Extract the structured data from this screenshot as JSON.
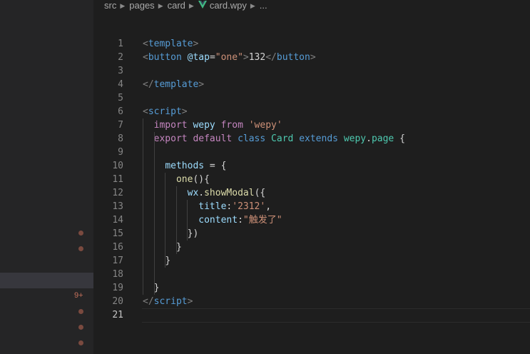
{
  "breadcrumb": {
    "items": [
      "src",
      "pages",
      "card",
      "card.wpy",
      "..."
    ],
    "file_icon": "vue-icon"
  },
  "sidebar": {
    "badge": "9+",
    "markers": [
      "dot-icon",
      "dot-icon",
      "dot-icon",
      "dot-icon",
      "dot-icon"
    ]
  },
  "editor": {
    "active_line": "21",
    "lines": [
      {
        "n": "1",
        "tokens": [
          [
            "<",
            "t-punc"
          ],
          [
            "template",
            "t-tag"
          ],
          [
            ">",
            "t-punc"
          ]
        ]
      },
      {
        "n": "2",
        "tokens": [
          [
            "<",
            "t-punc"
          ],
          [
            "button",
            "t-tag"
          ],
          [
            " ",
            "t-text"
          ],
          [
            "@tap",
            "t-attr"
          ],
          [
            "=",
            "t-text"
          ],
          [
            "\"one\"",
            "t-str"
          ],
          [
            ">",
            "t-punc"
          ],
          [
            "132",
            "t-text"
          ],
          [
            "</",
            "t-punc"
          ],
          [
            "button",
            "t-tag"
          ],
          [
            ">",
            "t-punc"
          ]
        ]
      },
      {
        "n": "3",
        "tokens": []
      },
      {
        "n": "4",
        "tokens": [
          [
            "</",
            "t-punc"
          ],
          [
            "template",
            "t-tag"
          ],
          [
            ">",
            "t-punc"
          ]
        ]
      },
      {
        "n": "5",
        "tokens": []
      },
      {
        "n": "6",
        "tokens": [
          [
            "<",
            "t-punc"
          ],
          [
            "script",
            "t-tag"
          ],
          [
            ">",
            "t-punc"
          ]
        ]
      },
      {
        "n": "7",
        "tokens": [
          [
            "  ",
            "t-text"
          ],
          [
            "import",
            "t-kw"
          ],
          [
            " ",
            "t-text"
          ],
          [
            "wepy",
            "t-var"
          ],
          [
            " ",
            "t-text"
          ],
          [
            "from",
            "t-kw"
          ],
          [
            " ",
            "t-text"
          ],
          [
            "'wepy'",
            "t-str"
          ]
        ]
      },
      {
        "n": "8",
        "tokens": [
          [
            "  ",
            "t-text"
          ],
          [
            "export",
            "t-kw"
          ],
          [
            " ",
            "t-text"
          ],
          [
            "default",
            "t-kw"
          ],
          [
            " ",
            "t-text"
          ],
          [
            "class",
            "t-kwb"
          ],
          [
            " ",
            "t-text"
          ],
          [
            "Card",
            "t-cls"
          ],
          [
            " ",
            "t-text"
          ],
          [
            "extends",
            "t-kwb"
          ],
          [
            " ",
            "t-text"
          ],
          [
            "wepy",
            "t-cls"
          ],
          [
            ".",
            "t-text"
          ],
          [
            "page",
            "t-cls"
          ],
          [
            " {",
            "t-text"
          ]
        ]
      },
      {
        "n": "9",
        "tokens": []
      },
      {
        "n": "10",
        "tokens": [
          [
            "    ",
            "t-text"
          ],
          [
            "methods",
            "t-var"
          ],
          [
            " = {",
            "t-text"
          ]
        ]
      },
      {
        "n": "11",
        "tokens": [
          [
            "      ",
            "t-text"
          ],
          [
            "one",
            "t-fn"
          ],
          [
            "(){",
            "t-text"
          ]
        ]
      },
      {
        "n": "12",
        "tokens": [
          [
            "        ",
            "t-text"
          ],
          [
            "wx",
            "t-var"
          ],
          [
            ".",
            "t-text"
          ],
          [
            "showModal",
            "t-fn"
          ],
          [
            "({",
            "t-text"
          ]
        ]
      },
      {
        "n": "13",
        "tokens": [
          [
            "          ",
            "t-text"
          ],
          [
            "title",
            "t-var"
          ],
          [
            ":",
            "t-text"
          ],
          [
            "'2312'",
            "t-str"
          ],
          [
            ",",
            "t-text"
          ]
        ]
      },
      {
        "n": "14",
        "tokens": [
          [
            "          ",
            "t-text"
          ],
          [
            "content",
            "t-var"
          ],
          [
            ":",
            "t-text"
          ],
          [
            "\"触发了\"",
            "t-str"
          ]
        ]
      },
      {
        "n": "15",
        "tokens": [
          [
            "        ",
            "t-text"
          ],
          [
            "})",
            "t-text"
          ]
        ]
      },
      {
        "n": "16",
        "tokens": [
          [
            "      ",
            "t-text"
          ],
          [
            "}",
            "t-text"
          ]
        ]
      },
      {
        "n": "17",
        "tokens": [
          [
            "    ",
            "t-text"
          ],
          [
            "}",
            "t-text"
          ]
        ]
      },
      {
        "n": "18",
        "tokens": []
      },
      {
        "n": "19",
        "tokens": [
          [
            "  ",
            "t-text"
          ],
          [
            "}",
            "t-text"
          ]
        ]
      },
      {
        "n": "20",
        "tokens": [
          [
            "</",
            "t-punc"
          ],
          [
            "script",
            "t-tag"
          ],
          [
            ">",
            "t-punc"
          ]
        ]
      },
      {
        "n": "21",
        "tokens": []
      }
    ]
  }
}
